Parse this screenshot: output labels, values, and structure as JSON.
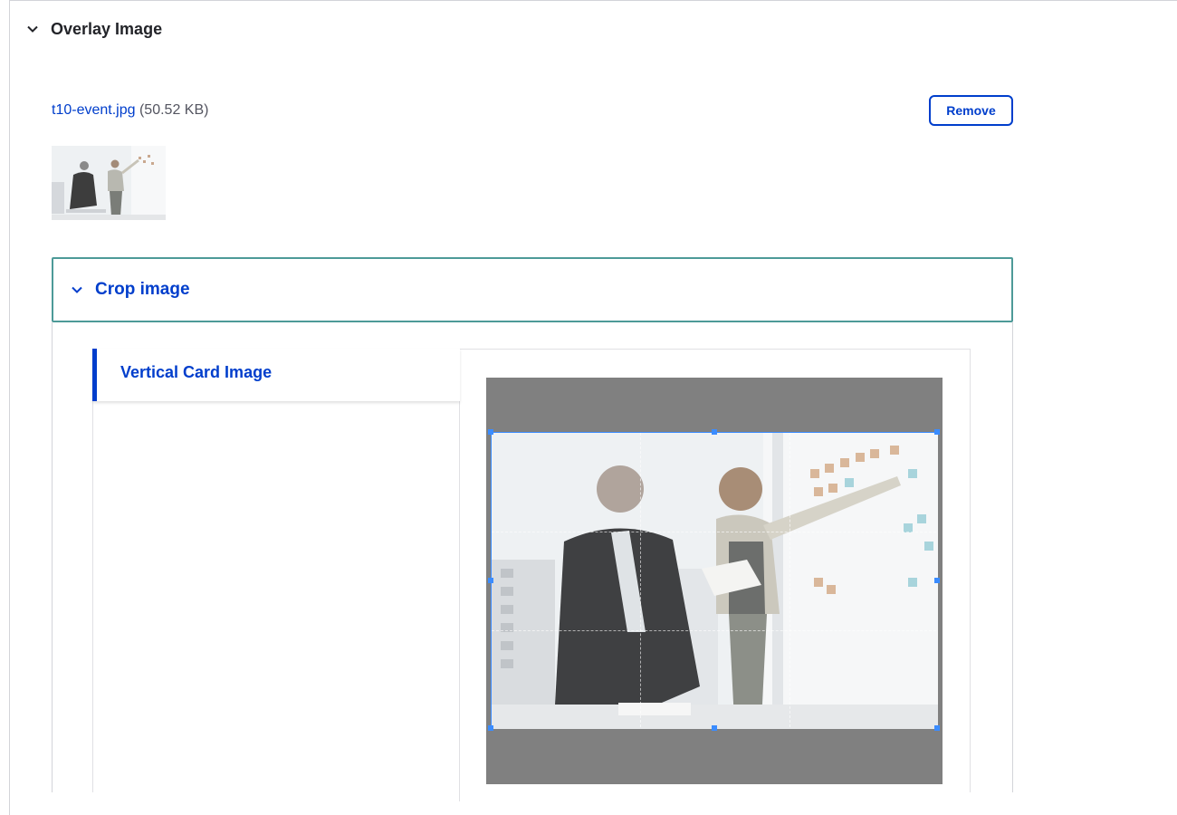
{
  "overlay": {
    "title": "Overlay Image",
    "file_name": "t10-event.jpg",
    "file_size": "(50.52 KB)",
    "remove_label": "Remove"
  },
  "crop": {
    "title": "Crop image",
    "tab_label": "Vertical Card Image"
  },
  "colors": {
    "accent": "#003ecc",
    "focus_border": "#4d9a98",
    "crop_handle": "#3b8cff",
    "crop_backdrop": "#808080"
  },
  "icons": {
    "overlay_toggle": "chevron-down-icon",
    "crop_toggle": "chevron-down-icon"
  }
}
